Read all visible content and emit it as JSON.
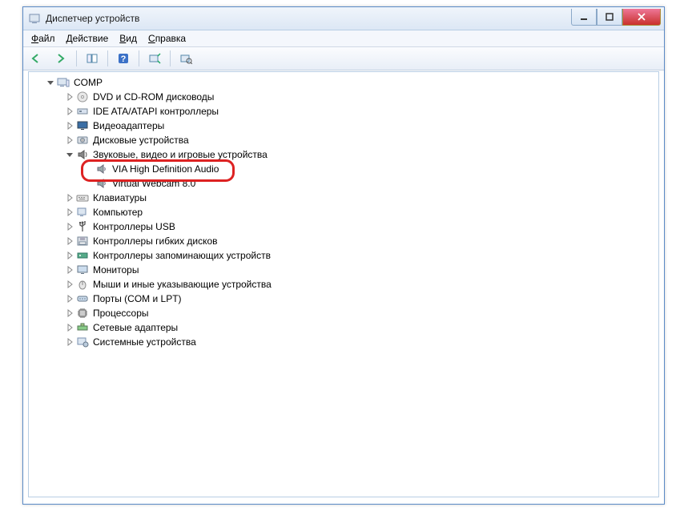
{
  "window": {
    "title": "Диспетчер устройств"
  },
  "menu": {
    "file": "Файл",
    "action": "Действие",
    "view": "Вид",
    "help": "Справка"
  },
  "tree": {
    "root": "COMP",
    "items": [
      {
        "label": "DVD и CD-ROM дисководы",
        "icon": "disc"
      },
      {
        "label": "IDE ATA/ATAPI контроллеры",
        "icon": "ide"
      },
      {
        "label": "Видеоадаптеры",
        "icon": "display"
      },
      {
        "label": "Дисковые устройства",
        "icon": "hdd"
      },
      {
        "label": "Звуковые, видео и игровые устройства",
        "icon": "sound",
        "expanded": true,
        "children": [
          {
            "label": "VIA High Definition Audio",
            "icon": "speaker",
            "highlight": true
          },
          {
            "label": "Virtual Webcam 8.0",
            "icon": "speaker"
          }
        ]
      },
      {
        "label": "Клавиатуры",
        "icon": "keyboard"
      },
      {
        "label": "Компьютер",
        "icon": "computer"
      },
      {
        "label": "Контроллеры USB",
        "icon": "usb"
      },
      {
        "label": "Контроллеры гибких дисков",
        "icon": "fdc"
      },
      {
        "label": "Контроллеры запоминающих устройств",
        "icon": "storage"
      },
      {
        "label": "Мониторы",
        "icon": "monitor"
      },
      {
        "label": "Мыши и иные указывающие устройства",
        "icon": "mouse"
      },
      {
        "label": "Порты (COM и LPT)",
        "icon": "port"
      },
      {
        "label": "Процессоры",
        "icon": "cpu"
      },
      {
        "label": "Сетевые адаптеры",
        "icon": "net"
      },
      {
        "label": "Системные устройства",
        "icon": "system"
      }
    ]
  }
}
